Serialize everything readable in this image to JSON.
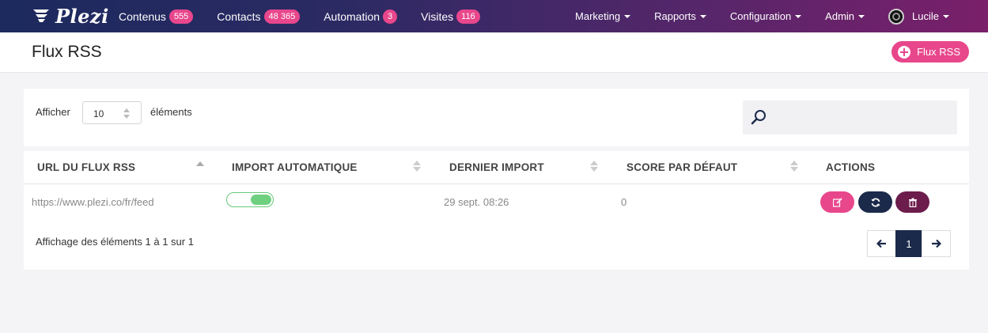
{
  "brand": {
    "logo_text": "Plezi"
  },
  "nav": {
    "left": [
      {
        "label": "Contenus",
        "count": "555"
      },
      {
        "label": "Contacts",
        "count": "48 365"
      },
      {
        "label": "Automation",
        "count": "3"
      },
      {
        "label": "Visites",
        "count": "116"
      }
    ],
    "right": [
      "Marketing",
      "Rapports",
      "Configuration",
      "Admin"
    ],
    "user": "Lucile"
  },
  "header": {
    "title": "Flux RSS",
    "add_button": "Flux RSS"
  },
  "controls": {
    "show_label": "Afficher",
    "page_length": "10",
    "elements_label": "éléments",
    "search_value": ""
  },
  "table": {
    "columns": [
      "URL DU FLUX RSS",
      "IMPORT AUTOMATIQUE",
      "DERNIER IMPORT",
      "SCORE PAR DÉFAUT",
      "ACTIONS"
    ],
    "rows": [
      {
        "url": "https://www.plezi.co/fr/feed",
        "auto_import": true,
        "last_import": "29 sept. 08:26",
        "score": "0"
      }
    ]
  },
  "footer": {
    "info": "Affichage des éléments 1 à 1 sur 1",
    "current_page": "1"
  },
  "colors": {
    "accent": "#e8478c",
    "dark": "#1b2a4a",
    "plum": "#6c1d4c",
    "toggle_on": "#6fd07f"
  }
}
